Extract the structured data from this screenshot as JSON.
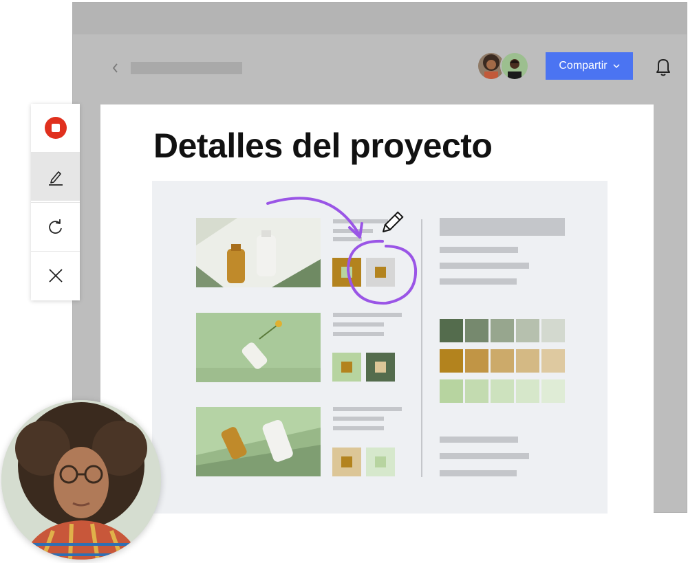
{
  "header": {
    "share_button_label": "Compartir",
    "icons": [
      "chevron-left-icon",
      "chevron-down-icon",
      "bell-icon"
    ]
  },
  "document": {
    "title": "Detalles del proyecto"
  },
  "toolbar": {
    "tools": [
      "stop-record-icon",
      "pen-icon",
      "redo-icon",
      "close-icon"
    ],
    "record_color": "#e0301e"
  },
  "colors": {
    "share_button": "#4b74f2",
    "annotation": "#9a55e6",
    "olive_dark": "#546c4d",
    "mustard": "#b3831e",
    "sage_light": "#b7d4a0"
  }
}
